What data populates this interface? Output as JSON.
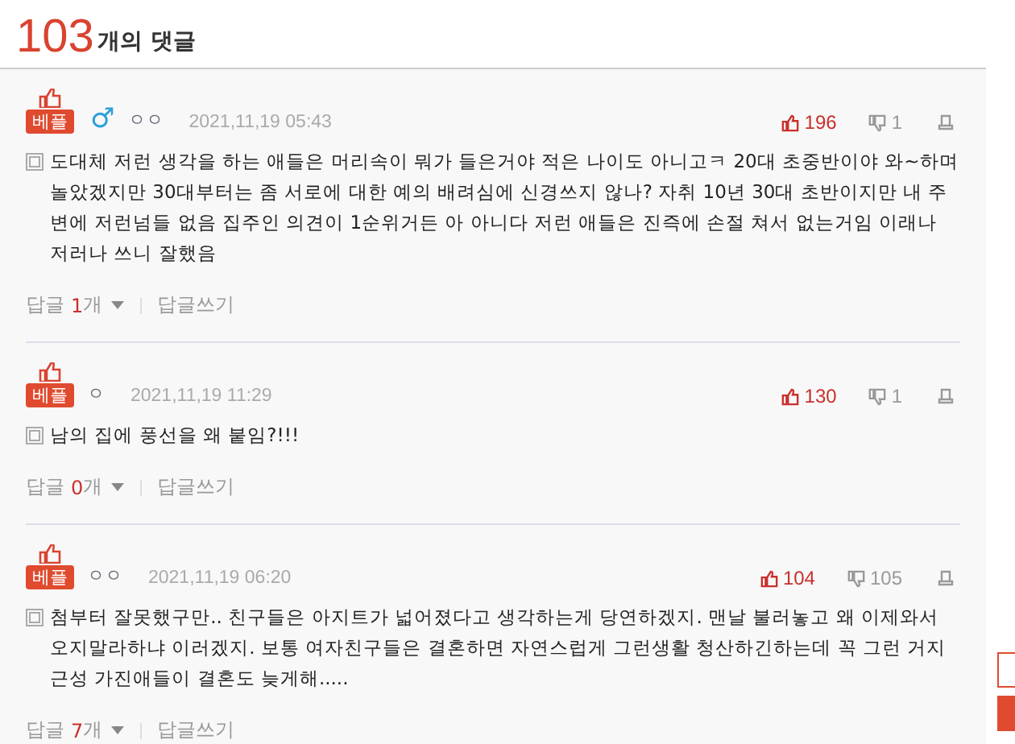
{
  "header": {
    "count": "103",
    "label": "개의 댓글"
  },
  "comments": [
    {
      "badge": "베플",
      "gender_symbol": "♂",
      "author": "ㅇㅇ",
      "date": "2021,11,19 05:43",
      "likes": "196",
      "dislikes": "1",
      "text": "도대체 저런 생각을 하는 애들은 머리속이 뭐가 들은거야 적은 나이도 아니고ㅋ 20대 초중반이야 와~하며 놀았겠지만 30대부터는 좀 서로에 대한 예의 배려심에 신경쓰지 않나? 자취 10년 30대 초반이지만 내 주변에 저런넘들 없음 집주인 의견이 1순위거든 아 아니다 저런 애들은 진즉에 손절 쳐서 없는거임 이래나 저러나 쓰니 잘했음",
      "reply_label": "답글",
      "reply_count": "1",
      "reply_unit": "개",
      "write_label": "답글쓰기"
    },
    {
      "badge": "베플",
      "author": "ㅇ",
      "date": "2021,11,19 11:29",
      "likes": "130",
      "dislikes": "1",
      "text": "남의 집에 풍선을 왜 붙임?!!!",
      "reply_label": "답글",
      "reply_count": "0",
      "reply_unit": "개",
      "write_label": "답글쓰기"
    },
    {
      "badge": "베플",
      "author": "ㅇㅇ",
      "date": "2021,11,19 06:20",
      "likes": "104",
      "dislikes": "105",
      "text": "첨부터 잘못했구만.. 친구들은 아지트가 넓어졌다고 생각하는게 당연하겠지. 맨날 불러놓고 왜 이제와서 오지말라하냐 이러겠지. 보통 여자친구들은 결혼하면 자연스럽게 그런생활 청산하긴하는데 꼭 그런 거지근성 가진애들이 결혼도 늦게해.....",
      "reply_label": "답글",
      "reply_count": "7",
      "reply_unit": "개",
      "write_label": "답글쓰기"
    }
  ]
}
